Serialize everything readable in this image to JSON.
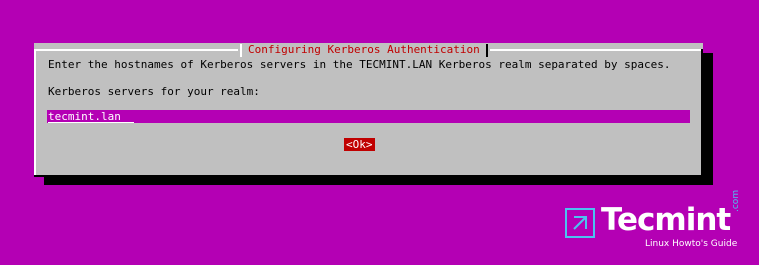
{
  "dialog": {
    "title": "Configuring Kerberos Authentication",
    "prompt": "Enter the hostnames of Kerberos servers in the TECMINT.LAN Kerberos realm separated by spaces.",
    "field_label": "Kerberos servers for your realm:",
    "field_value": "tecmint.lan",
    "ok_label": "<Ok>"
  },
  "watermark": {
    "name": "Tecmint",
    "suffix": ".com",
    "tagline": "Linux Howto's Guide",
    "icon": "tecmint-logo-icon"
  },
  "colors": {
    "background": "#b400b4",
    "dialog": "#c0c0c0",
    "title_text": "#c00000",
    "button": "#c00000",
    "input_bg": "#b400b4",
    "accent": "#4cc3f0"
  }
}
